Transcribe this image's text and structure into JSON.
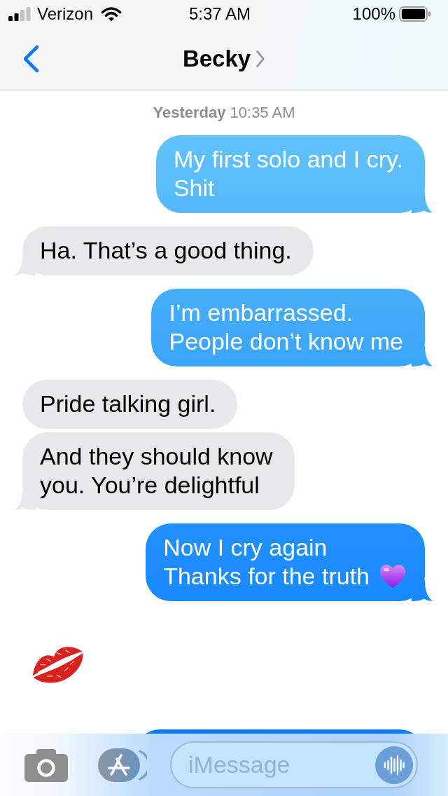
{
  "status_bar": {
    "carrier": "Verizon",
    "time": "5:37 AM",
    "battery": "100%"
  },
  "nav_bar": {
    "title": "Becky"
  },
  "conversation": {
    "timestamp": "**Yesterday** 10:35 AM",
    "messages": [
      {
        "outgoing": true,
        "kind": "text",
        "lines": [
          "My first solo and I cry.",
          "Shit"
        ],
        "tail": true
      },
      {
        "outgoing": false,
        "kind": "text",
        "lines": [
          "Ha. That’s a good thing."
        ],
        "tail": true
      },
      {
        "outgoing": true,
        "kind": "text",
        "lines": [
          "I’m embarrassed.",
          "People don’t know me"
        ],
        "tail": true
      },
      {
        "outgoing": false,
        "kind": "text",
        "lines": [
          "Pride talking girl."
        ],
        "tail": false
      },
      {
        "outgoing": false,
        "kind": "text",
        "lines": [
          "And they should know",
          "you. You’re delightful"
        ],
        "tail": true
      },
      {
        "outgoing": true,
        "kind": "text-emoji",
        "lines": [
          "Now I cry again",
          "Thanks for the truth"
        ],
        "tail": true
      },
      {
        "outgoing": false,
        "kind": "emoji"
      },
      {
        "outgoing": true,
        "kind": "partial",
        "tail": false
      }
    ]
  },
  "compose_bar": {
    "placeholder": "iMessage"
  }
}
